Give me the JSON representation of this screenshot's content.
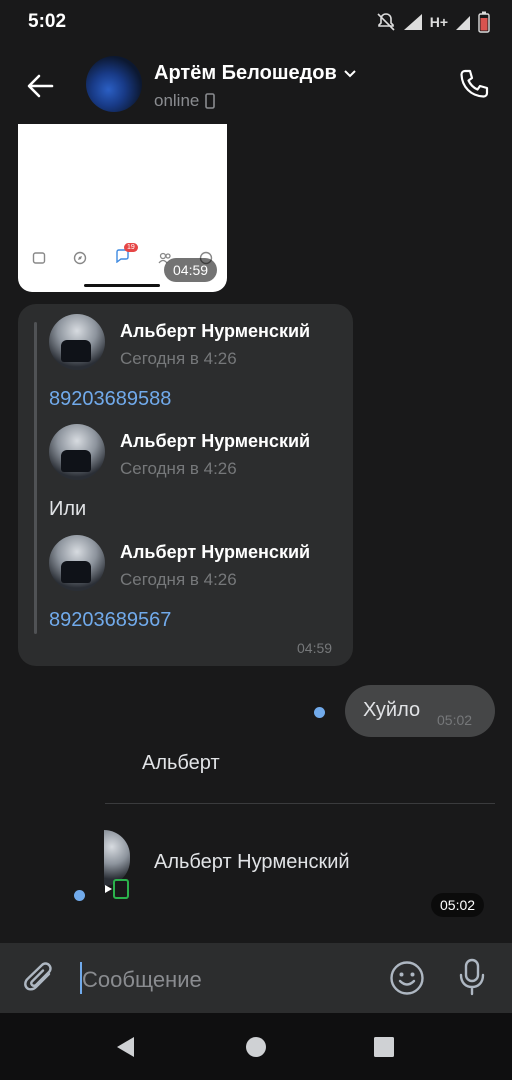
{
  "status_bar": {
    "time": "5:02",
    "network": "H+"
  },
  "header": {
    "name": "Артём Белошедов",
    "status": "online"
  },
  "screenshot_message": {
    "time": "04:59",
    "badge": "19"
  },
  "forwarded_message": {
    "items": [
      {
        "author": "Альберт Нурменский",
        "date": "Сегодня в 4:26",
        "text": "89203689588",
        "is_link": true
      },
      {
        "author": "Альберт Нурменский",
        "date": "Сегодня в 4:26",
        "text": "Или",
        "is_link": false
      },
      {
        "author": "Альберт Нурменский",
        "date": "Сегодня в 4:26",
        "text": "89203689567",
        "is_link": true
      }
    ],
    "time": "04:59"
  },
  "outgoing_message": {
    "text": "Хуйло",
    "time": "05:02"
  },
  "label_message": {
    "text": "Альберт"
  },
  "contact_card": {
    "name": "Альберт Нурменский",
    "time": "05:02"
  },
  "composer": {
    "placeholder": "Сообщение"
  },
  "colors": {
    "background": "#19191a",
    "bubble": "#2c2d2e",
    "link": "#71aaeb",
    "online": "#2bb24c"
  }
}
